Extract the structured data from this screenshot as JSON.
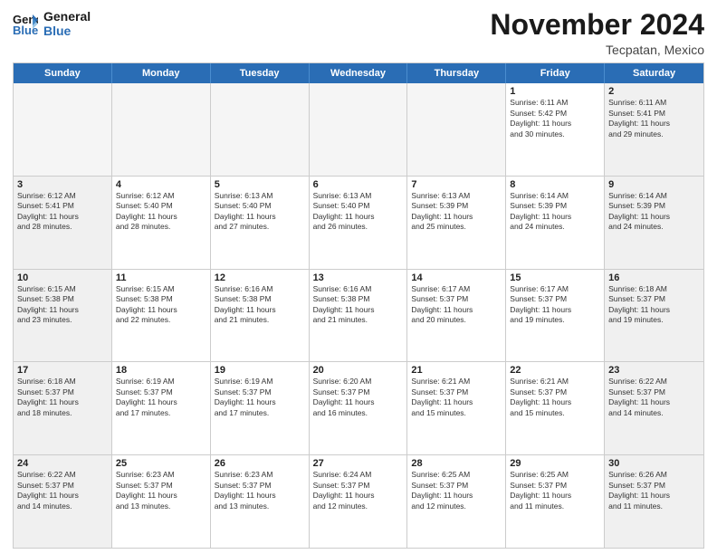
{
  "header": {
    "logo_line1": "General",
    "logo_line2": "Blue",
    "month_title": "November 2024",
    "location": "Tecpatan, Mexico"
  },
  "weekdays": [
    "Sunday",
    "Monday",
    "Tuesday",
    "Wednesday",
    "Thursday",
    "Friday",
    "Saturday"
  ],
  "rows": [
    [
      {
        "day": "",
        "info": "",
        "empty": true
      },
      {
        "day": "",
        "info": "",
        "empty": true
      },
      {
        "day": "",
        "info": "",
        "empty": true
      },
      {
        "day": "",
        "info": "",
        "empty": true
      },
      {
        "day": "",
        "info": "",
        "empty": true
      },
      {
        "day": "1",
        "info": "Sunrise: 6:11 AM\nSunset: 5:42 PM\nDaylight: 11 hours\nand 30 minutes.",
        "empty": false
      },
      {
        "day": "2",
        "info": "Sunrise: 6:11 AM\nSunset: 5:41 PM\nDaylight: 11 hours\nand 29 minutes.",
        "empty": false
      }
    ],
    [
      {
        "day": "3",
        "info": "Sunrise: 6:12 AM\nSunset: 5:41 PM\nDaylight: 11 hours\nand 28 minutes.",
        "empty": false
      },
      {
        "day": "4",
        "info": "Sunrise: 6:12 AM\nSunset: 5:40 PM\nDaylight: 11 hours\nand 28 minutes.",
        "empty": false
      },
      {
        "day": "5",
        "info": "Sunrise: 6:13 AM\nSunset: 5:40 PM\nDaylight: 11 hours\nand 27 minutes.",
        "empty": false
      },
      {
        "day": "6",
        "info": "Sunrise: 6:13 AM\nSunset: 5:40 PM\nDaylight: 11 hours\nand 26 minutes.",
        "empty": false
      },
      {
        "day": "7",
        "info": "Sunrise: 6:13 AM\nSunset: 5:39 PM\nDaylight: 11 hours\nand 25 minutes.",
        "empty": false
      },
      {
        "day": "8",
        "info": "Sunrise: 6:14 AM\nSunset: 5:39 PM\nDaylight: 11 hours\nand 24 minutes.",
        "empty": false
      },
      {
        "day": "9",
        "info": "Sunrise: 6:14 AM\nSunset: 5:39 PM\nDaylight: 11 hours\nand 24 minutes.",
        "empty": false
      }
    ],
    [
      {
        "day": "10",
        "info": "Sunrise: 6:15 AM\nSunset: 5:38 PM\nDaylight: 11 hours\nand 23 minutes.",
        "empty": false
      },
      {
        "day": "11",
        "info": "Sunrise: 6:15 AM\nSunset: 5:38 PM\nDaylight: 11 hours\nand 22 minutes.",
        "empty": false
      },
      {
        "day": "12",
        "info": "Sunrise: 6:16 AM\nSunset: 5:38 PM\nDaylight: 11 hours\nand 21 minutes.",
        "empty": false
      },
      {
        "day": "13",
        "info": "Sunrise: 6:16 AM\nSunset: 5:38 PM\nDaylight: 11 hours\nand 21 minutes.",
        "empty": false
      },
      {
        "day": "14",
        "info": "Sunrise: 6:17 AM\nSunset: 5:37 PM\nDaylight: 11 hours\nand 20 minutes.",
        "empty": false
      },
      {
        "day": "15",
        "info": "Sunrise: 6:17 AM\nSunset: 5:37 PM\nDaylight: 11 hours\nand 19 minutes.",
        "empty": false
      },
      {
        "day": "16",
        "info": "Sunrise: 6:18 AM\nSunset: 5:37 PM\nDaylight: 11 hours\nand 19 minutes.",
        "empty": false
      }
    ],
    [
      {
        "day": "17",
        "info": "Sunrise: 6:18 AM\nSunset: 5:37 PM\nDaylight: 11 hours\nand 18 minutes.",
        "empty": false
      },
      {
        "day": "18",
        "info": "Sunrise: 6:19 AM\nSunset: 5:37 PM\nDaylight: 11 hours\nand 17 minutes.",
        "empty": false
      },
      {
        "day": "19",
        "info": "Sunrise: 6:19 AM\nSunset: 5:37 PM\nDaylight: 11 hours\nand 17 minutes.",
        "empty": false
      },
      {
        "day": "20",
        "info": "Sunrise: 6:20 AM\nSunset: 5:37 PM\nDaylight: 11 hours\nand 16 minutes.",
        "empty": false
      },
      {
        "day": "21",
        "info": "Sunrise: 6:21 AM\nSunset: 5:37 PM\nDaylight: 11 hours\nand 15 minutes.",
        "empty": false
      },
      {
        "day": "22",
        "info": "Sunrise: 6:21 AM\nSunset: 5:37 PM\nDaylight: 11 hours\nand 15 minutes.",
        "empty": false
      },
      {
        "day": "23",
        "info": "Sunrise: 6:22 AM\nSunset: 5:37 PM\nDaylight: 11 hours\nand 14 minutes.",
        "empty": false
      }
    ],
    [
      {
        "day": "24",
        "info": "Sunrise: 6:22 AM\nSunset: 5:37 PM\nDaylight: 11 hours\nand 14 minutes.",
        "empty": false
      },
      {
        "day": "25",
        "info": "Sunrise: 6:23 AM\nSunset: 5:37 PM\nDaylight: 11 hours\nand 13 minutes.",
        "empty": false
      },
      {
        "day": "26",
        "info": "Sunrise: 6:23 AM\nSunset: 5:37 PM\nDaylight: 11 hours\nand 13 minutes.",
        "empty": false
      },
      {
        "day": "27",
        "info": "Sunrise: 6:24 AM\nSunset: 5:37 PM\nDaylight: 11 hours\nand 12 minutes.",
        "empty": false
      },
      {
        "day": "28",
        "info": "Sunrise: 6:25 AM\nSunset: 5:37 PM\nDaylight: 11 hours\nand 12 minutes.",
        "empty": false
      },
      {
        "day": "29",
        "info": "Sunrise: 6:25 AM\nSunset: 5:37 PM\nDaylight: 11 hours\nand 11 minutes.",
        "empty": false
      },
      {
        "day": "30",
        "info": "Sunrise: 6:26 AM\nSunset: 5:37 PM\nDaylight: 11 hours\nand 11 minutes.",
        "empty": false
      }
    ]
  ]
}
